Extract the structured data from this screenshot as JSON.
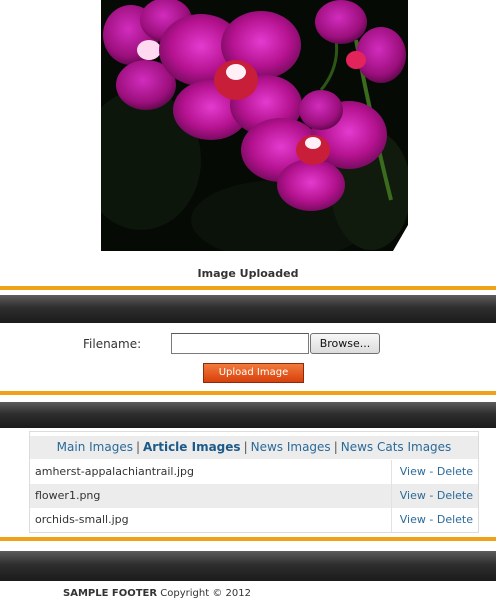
{
  "uploaded_image": {
    "caption": "Image Uploaded"
  },
  "upload_form": {
    "filename_label": "Filename:",
    "filename_value": "",
    "browse_label": "Browse...",
    "upload_label": "Upload Image"
  },
  "image_tabs": [
    {
      "label": "Main Images",
      "active": false
    },
    {
      "label": "Article Images",
      "active": true
    },
    {
      "label": "News Images",
      "active": false
    },
    {
      "label": "News Cats Images",
      "active": false
    }
  ],
  "tab_separator": "|",
  "files": [
    {
      "name": "amherst-appalachiantrail.jpg",
      "view": "View",
      "sep": "-",
      "delete": "Delete"
    },
    {
      "name": "flower1.png",
      "view": "View",
      "sep": "-",
      "delete": "Delete"
    },
    {
      "name": "orchids-small.jpg",
      "view": "View",
      "sep": "-",
      "delete": "Delete"
    }
  ],
  "footer": {
    "brand": "SAMPLE FOOTER",
    "copyright": "Copyright © 2012"
  },
  "colors": {
    "accent_orange": "#f0a11a",
    "band_dark": "#2e2e2e",
    "link_blue": "#2a6a99",
    "upload_button": "#e05a1e",
    "orchid_magenta": "#c51aa0"
  }
}
